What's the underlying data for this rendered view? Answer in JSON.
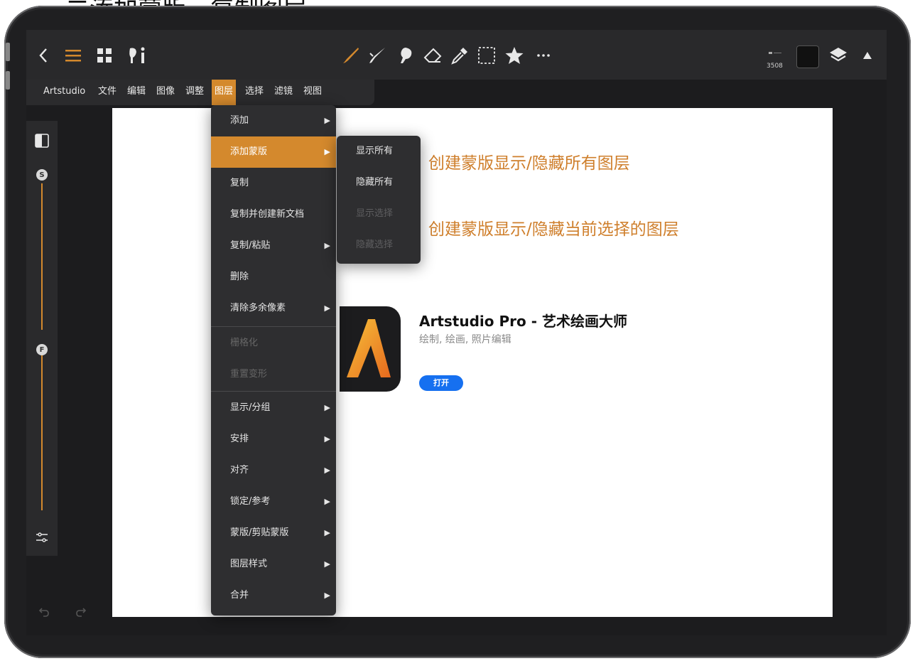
{
  "caption": "二添加蒙版、复制图层",
  "toolbar": {
    "size_value": "3508"
  },
  "menubar": {
    "items": [
      "Artstudio",
      "文件",
      "编辑",
      "图像",
      "调整",
      "图层",
      "选择",
      "滤镜",
      "视图"
    ],
    "active": "图层"
  },
  "layer_menu": {
    "items": [
      {
        "label": "添加",
        "submenu": true
      },
      {
        "label": "添加蒙版",
        "submenu": true
      },
      {
        "label": "复制"
      },
      {
        "label": "复制并创建新文档"
      },
      {
        "label": "复制/粘贴",
        "submenu": true
      },
      {
        "label": "删除"
      },
      {
        "label": "清除多余像素",
        "submenu": true
      },
      {
        "label": "栅格化",
        "disabled": true
      },
      {
        "label": "重置变形",
        "disabled": true
      },
      {
        "label": "显示/分组",
        "submenu": true
      },
      {
        "label": "安排",
        "submenu": true
      },
      {
        "label": "对齐",
        "submenu": true
      },
      {
        "label": "锁定/参考",
        "submenu": true
      },
      {
        "label": "蒙版/剪贴蒙版",
        "submenu": true
      },
      {
        "label": "图层样式",
        "submenu": true
      },
      {
        "label": "合并",
        "submenu": true
      }
    ]
  },
  "mask_submenu": {
    "items": [
      {
        "label": "显示所有"
      },
      {
        "label": "隐藏所有"
      },
      {
        "label": "显示选择",
        "disabled": true
      },
      {
        "label": "隐藏选择",
        "disabled": true
      }
    ]
  },
  "annotations": {
    "all": "创建蒙版显示/隐藏所有图层",
    "selected": "创建蒙版显示/隐藏当前选择的图层"
  },
  "app_card": {
    "title": "Artstudio Pro - 艺术绘画大师",
    "subtitle": "绘制, 绘画, 照片编辑",
    "open_label": "打开"
  },
  "slider_labels": {
    "size": "S",
    "flow": "F"
  },
  "colors": {
    "accent": "#d4892d",
    "annotation": "#cf7f2c",
    "open_button": "#1670f0",
    "current_color": "#111111"
  }
}
